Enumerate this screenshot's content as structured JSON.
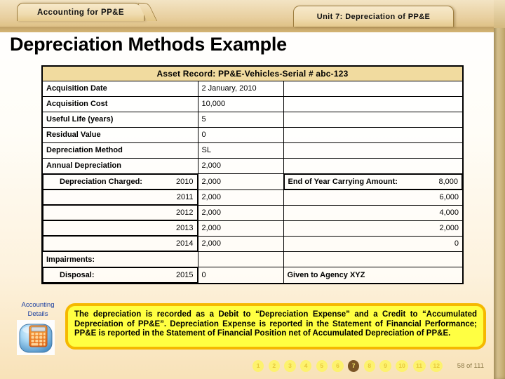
{
  "header": {
    "course_tab": "Accounting for PP&E",
    "unit_tab": "Unit 7: Depreciation of PP&E"
  },
  "title": "Depreciation Methods Example",
  "table": {
    "caption": "Asset Record:  PP&E-Vehicles-Serial # abc-123",
    "rows": [
      {
        "label": "Acquisition Date",
        "indent": false,
        "year": "",
        "value": "2 January, 2010",
        "note_left": "",
        "note_right": ""
      },
      {
        "label": "Acquisition Cost",
        "indent": false,
        "year": "",
        "value": "10,000",
        "note_left": "",
        "note_right": ""
      },
      {
        "label": "Useful Life (years)",
        "indent": false,
        "year": "",
        "value": "5",
        "note_left": "",
        "note_right": ""
      },
      {
        "label": "Residual Value",
        "indent": false,
        "year": "",
        "value": "0",
        "note_left": "",
        "note_right": ""
      },
      {
        "label": "Depreciation Method",
        "indent": false,
        "year": "",
        "value": "SL",
        "note_left": "",
        "note_right": ""
      },
      {
        "label": "Annual Depreciation",
        "indent": false,
        "year": "",
        "value": "2,000",
        "note_left": "",
        "note_right": ""
      },
      {
        "label": "Depreciation Charged:",
        "indent": true,
        "year": "2010",
        "value": "2,000",
        "note_left": "End of Year Carrying Amount:",
        "note_right": "8,000"
      },
      {
        "label": "",
        "indent": true,
        "year": "2011",
        "value": "2,000",
        "note_left": "",
        "note_right": "6,000"
      },
      {
        "label": "",
        "indent": true,
        "year": "2012",
        "value": "2,000",
        "note_left": "",
        "note_right": "4,000"
      },
      {
        "label": "",
        "indent": true,
        "year": "2013",
        "value": "2,000",
        "note_left": "",
        "note_right": "2,000"
      },
      {
        "label": "",
        "indent": true,
        "year": "2014",
        "value": "2,000",
        "note_left": "",
        "note_right": "0"
      },
      {
        "label": "Impairments:",
        "indent": false,
        "year": "",
        "value": "",
        "note_left": "",
        "note_right": ""
      },
      {
        "label": "Disposal:",
        "indent": true,
        "year": "2015",
        "value": "0",
        "note_left": "Given to Agency XYZ",
        "note_right": ""
      }
    ]
  },
  "sidebar": {
    "label_line1": "Accounting",
    "label_line2": "Details",
    "icon": "calculator-icon"
  },
  "callout": {
    "text": "The depreciation is recorded as a Debit to “Depreciation Expense” and a Credit to “Accumulated Depreciation of PP&E”. Depreciation Expense is reported in the Statement of Financial Performance; PP&E is reported in the Statement of Financial Position net of Accumulated Depreciation of PP&E."
  },
  "footer": {
    "pages": [
      "1",
      "2",
      "3",
      "4",
      "5",
      "6",
      "7",
      "8",
      "9",
      "10",
      "11",
      "12"
    ],
    "active_page": "7",
    "page_count": "58 of 111"
  },
  "colors": {
    "table_header": "#f1db9f",
    "callout_fill": "#ffff42",
    "callout_border": "#f5b800",
    "active_dot": "#7a5524",
    "dot": "#fdf26e",
    "sidebar_text": "#1b3fa0",
    "title_rule": "#9c7a3c"
  }
}
